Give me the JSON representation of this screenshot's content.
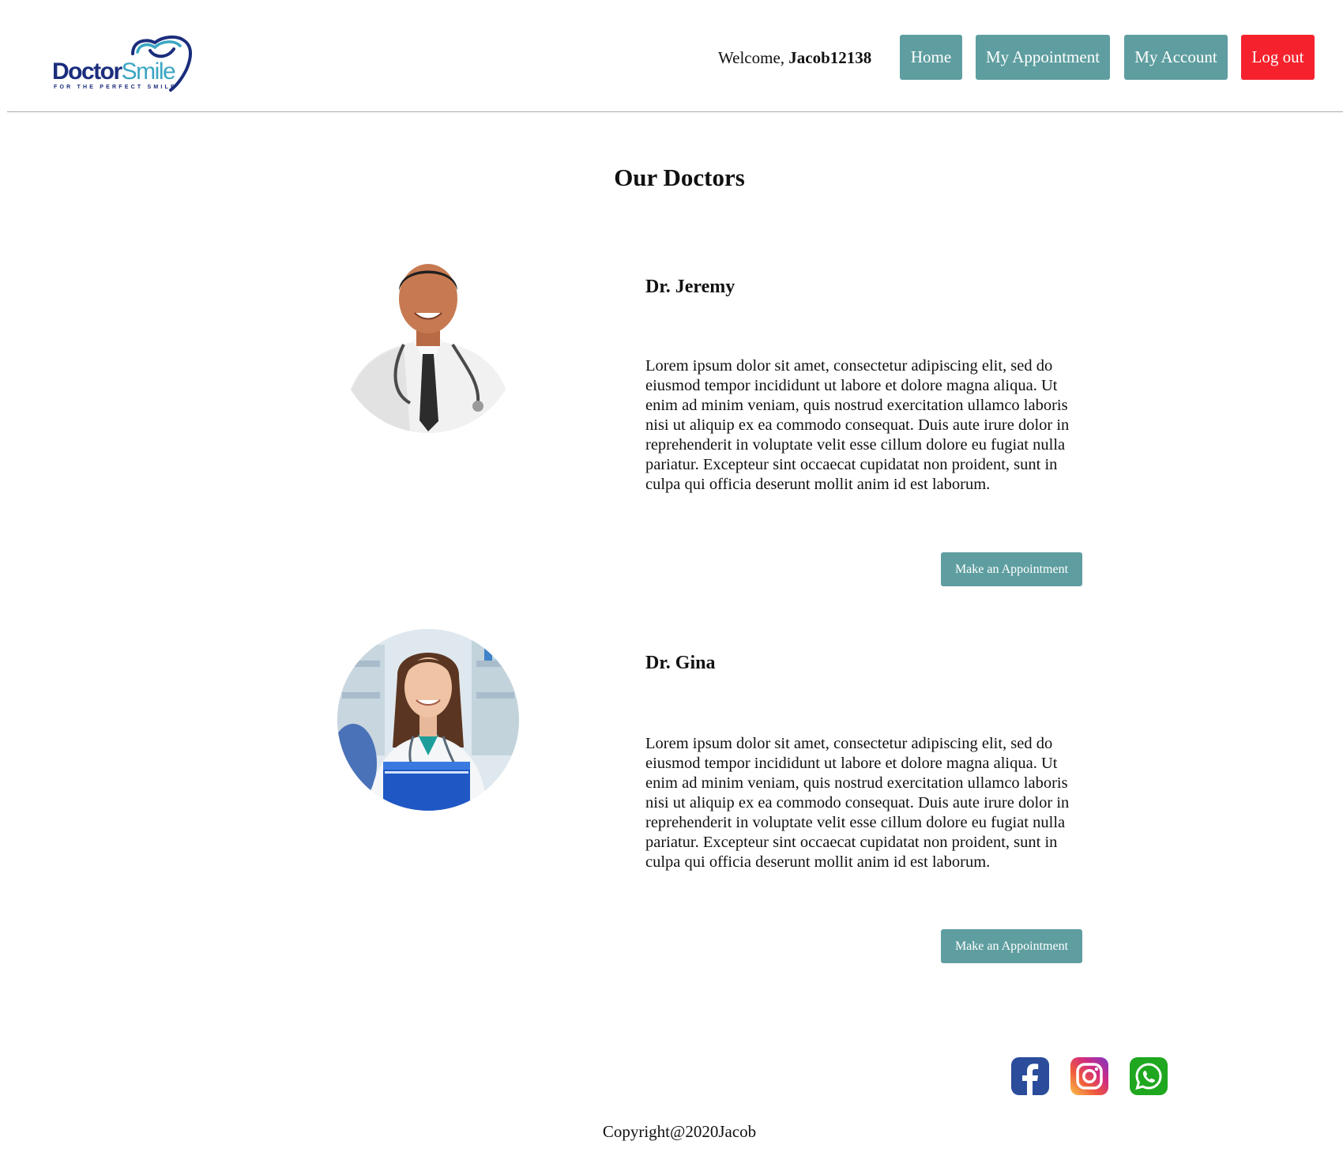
{
  "header": {
    "logo": {
      "word1": "Doctor",
      "word2": "Smile",
      "tagline": "FOR THE PERFECT SMILE"
    },
    "welcome_prefix": "Welcome, ",
    "username": "Jacob12138",
    "nav": {
      "home": "Home",
      "my_appointment": "My Appointment",
      "my_account": "My Account",
      "log_out": "Log out"
    }
  },
  "main": {
    "title": "Our Doctors",
    "doctors": [
      {
        "name": "Dr. Jeremy",
        "bio": "Lorem ipsum dolor sit amet, consectetur adipiscing elit, sed do eiusmod tempor incididunt ut labore et dolore magna aliqua. Ut enim ad minim veniam, quis nostrud exercitation ullamco laboris nisi ut aliquip ex ea commodo consequat. Duis aute irure dolor in reprehenderit in voluptate velit esse cillum dolore eu fugiat nulla pariatur. Excepteur sint occaecat cupidatat non proident, sunt in culpa qui officia deserunt mollit anim id est laborum.",
        "button": "Make an Appointment"
      },
      {
        "name": "Dr. Gina",
        "bio": "Lorem ipsum dolor sit amet, consectetur adipiscing elit, sed do eiusmod tempor incididunt ut labore et dolore magna aliqua. Ut enim ad minim veniam, quis nostrud exercitation ullamco laboris nisi ut aliquip ex ea commodo consequat. Duis aute irure dolor in reprehenderit in voluptate velit esse cillum dolore eu fugiat nulla pariatur. Excepteur sint occaecat cupidatat non proident, sunt in culpa qui officia deserunt mollit anim id est laborum.",
        "button": "Make an Appointment"
      }
    ]
  },
  "footer": {
    "social": [
      "facebook-icon",
      "instagram-icon",
      "whatsapp-icon"
    ],
    "copyright": "Copyright@2020Jacob"
  },
  "colors": {
    "nav_button": "#5f9ea0",
    "logout_button": "#f5222d",
    "logo_dark": "#1b2d7c",
    "logo_light": "#3aa6c3",
    "facebook": "#2a4c9b",
    "whatsapp": "#1fa71f"
  }
}
